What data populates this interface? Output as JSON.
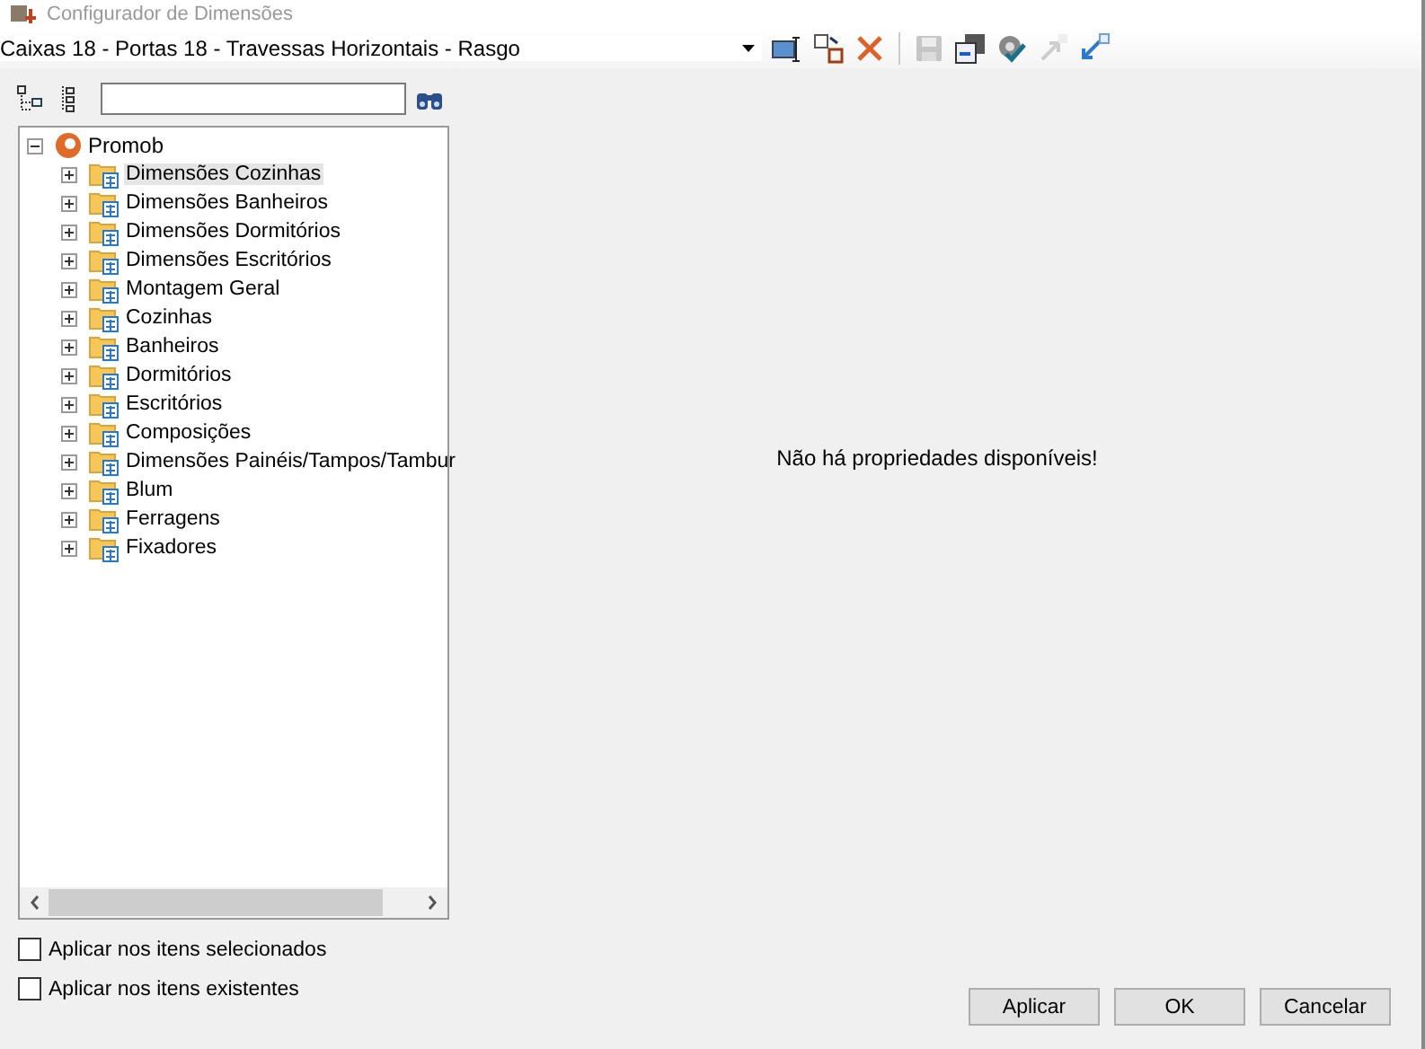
{
  "window": {
    "title": "Configurador de Dimensões"
  },
  "combo": {
    "value": "Caixas 18 - Portas 18 - Travessas Horizontais - Rasgo"
  },
  "toolbar": [
    {
      "kind": "rename",
      "disabled": false
    },
    {
      "kind": "replace",
      "disabled": false
    },
    {
      "kind": "delete",
      "disabled": false
    },
    {
      "kind": "separator"
    },
    {
      "kind": "save",
      "disabled": true
    },
    {
      "kind": "save-as",
      "disabled": false
    },
    {
      "kind": "settings",
      "disabled": false
    },
    {
      "kind": "export",
      "disabled": true
    },
    {
      "kind": "import",
      "disabled": false
    }
  ],
  "tree": {
    "label": "Promob",
    "expanded": true,
    "children": [
      {
        "label": "Dimensões Cozinhas",
        "selected": true
      },
      {
        "label": "Dimensões Banheiros",
        "selected": false
      },
      {
        "label": "Dimensões Dormitórios",
        "selected": false
      },
      {
        "label": "Dimensões Escritórios",
        "selected": false
      },
      {
        "label": "Montagem Geral",
        "selected": false
      },
      {
        "label": "Cozinhas",
        "selected": false
      },
      {
        "label": "Banheiros",
        "selected": false
      },
      {
        "label": "Dormitórios",
        "selected": false
      },
      {
        "label": "Escritórios",
        "selected": false
      },
      {
        "label": "Composições",
        "selected": false
      },
      {
        "label": "Dimensões Painéis/Tampos/Tambur",
        "selected": false
      },
      {
        "label": "Blum",
        "selected": false
      },
      {
        "label": "Ferragens",
        "selected": false
      },
      {
        "label": "Fixadores",
        "selected": false
      }
    ]
  },
  "message": "Não há propriedades disponíveis!",
  "options": [
    {
      "label": "Aplicar nos itens selecionados",
      "checked": false
    },
    {
      "label": "Aplicar nos itens existentes",
      "checked": false
    }
  ],
  "buttons": [
    "Aplicar",
    "OK",
    "Cancelar"
  ]
}
